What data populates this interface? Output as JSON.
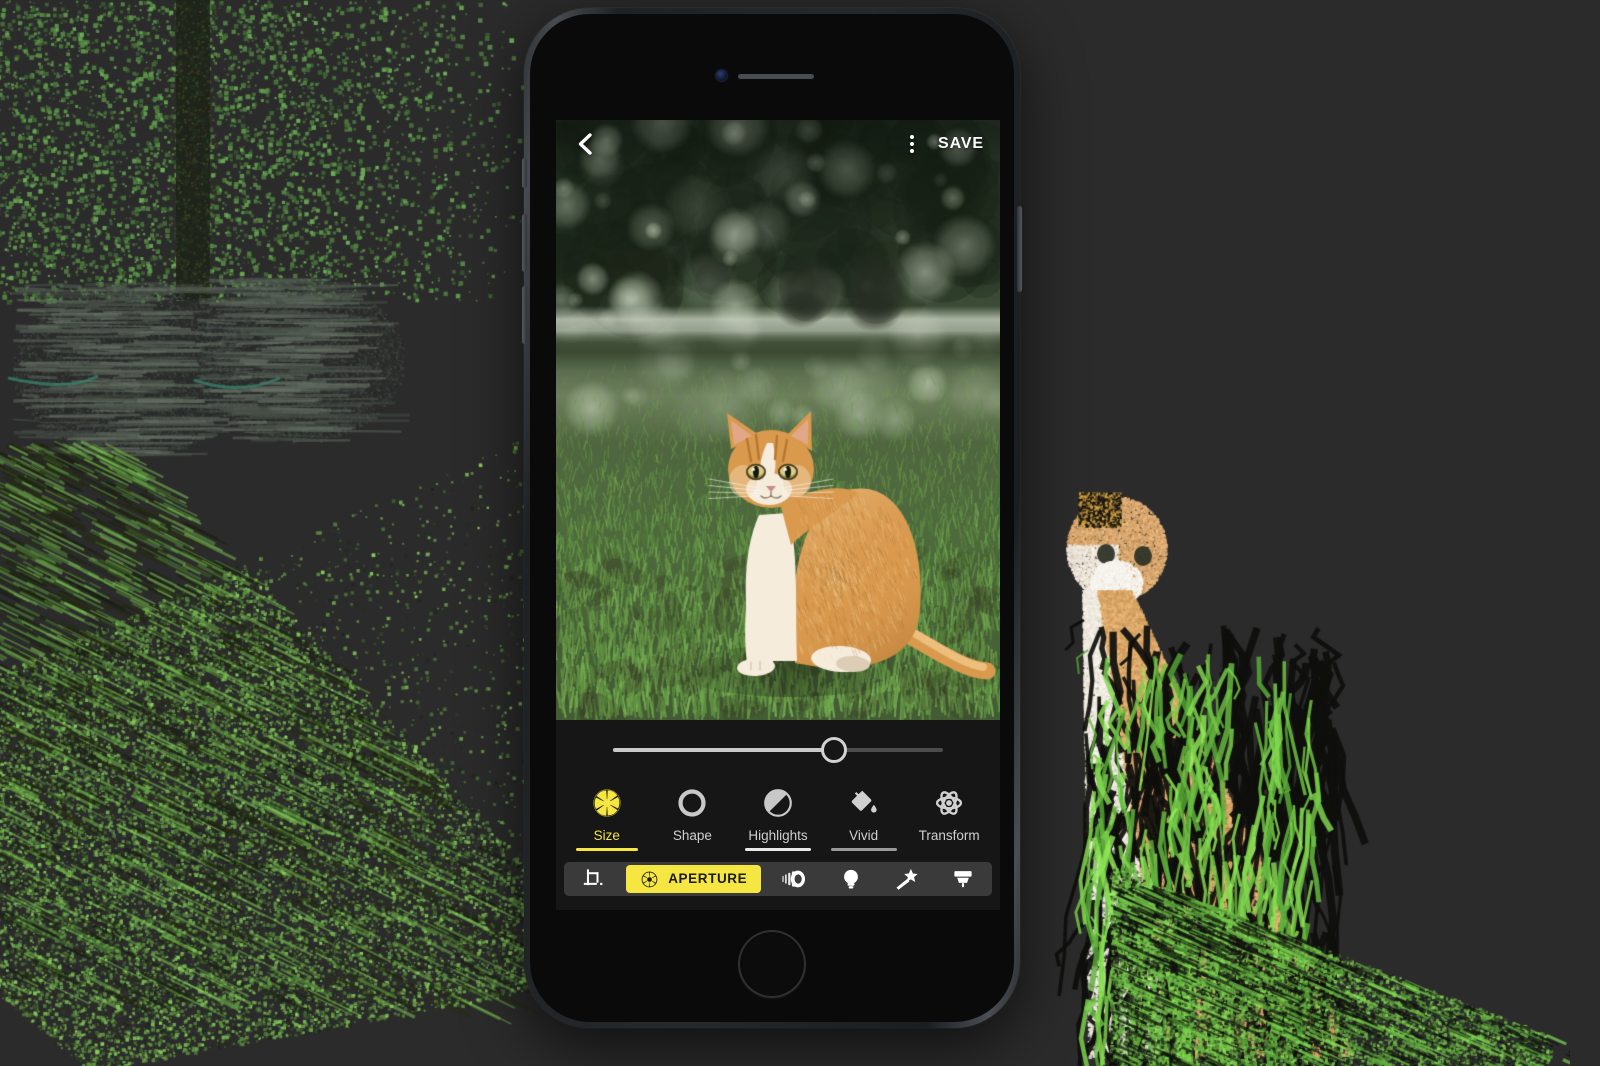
{
  "app": {
    "name": "photo-depth-editor",
    "accent_color": "#F5E642",
    "panel_color": "#161616",
    "strip_color": "#3A3A3A",
    "page_background": "#2B2B2B"
  },
  "topbar": {
    "back_icon": "chevron-left-icon",
    "overflow_icon": "overflow-menu-icon",
    "save_label": "SAVE"
  },
  "photo": {
    "subject": "orange-and-white cat sitting on grass",
    "alt": "Portrait-mode photo of a ginger tabby cat on a lawn with blurred trees behind"
  },
  "slider": {
    "name": "size-slider",
    "value_percent": 67,
    "min": 0,
    "max": 100
  },
  "tabs": [
    {
      "id": "size",
      "label": "Size",
      "icon": "aperture-icon",
      "active": true
    },
    {
      "id": "shape",
      "label": "Shape",
      "icon": "circle-icon",
      "active": false
    },
    {
      "id": "highlights",
      "label": "Highlights",
      "icon": "half-circle-icon",
      "active": false
    },
    {
      "id": "vivid",
      "label": "Vivid",
      "icon": "paint-bucket-icon",
      "active": false
    },
    {
      "id": "transform",
      "label": "Transform",
      "icon": "atom-icon",
      "active": false
    }
  ],
  "toolstrip": [
    {
      "id": "crop",
      "label": "",
      "icon": "crop-icon",
      "active": false
    },
    {
      "id": "aperture",
      "label": "APERTURE",
      "icon": "aperture-icon",
      "active": true
    },
    {
      "id": "lens",
      "label": "",
      "icon": "lens-blur-icon",
      "active": false
    },
    {
      "id": "light",
      "label": "",
      "icon": "lightbulb-icon",
      "active": false
    },
    {
      "id": "magic",
      "label": "",
      "icon": "magic-wand-icon",
      "active": false
    },
    {
      "id": "brush",
      "label": "",
      "icon": "brush-icon",
      "active": false
    }
  ],
  "device": {
    "model": "iphone-7-plus-black",
    "front_camera": "front-camera",
    "earpiece": "earpiece-speaker",
    "home_button": "home-button"
  },
  "background_scenes": {
    "left": "3d point-cloud reconstruction of dark animals on a grassy slope under trees",
    "right": "3d point-cloud reconstruction of the ginger cat with depth-streak artifacts"
  }
}
